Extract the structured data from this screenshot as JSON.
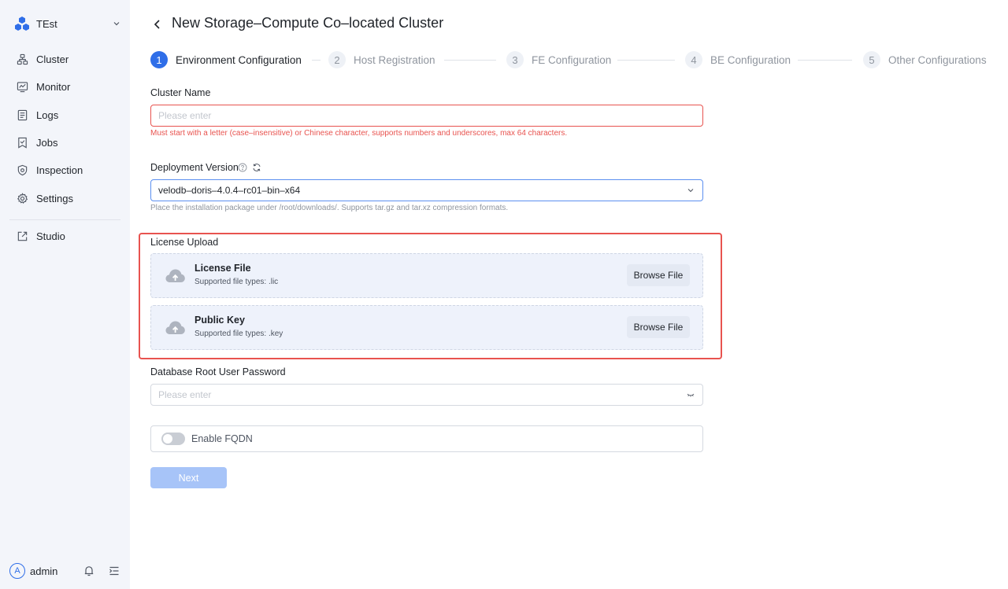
{
  "sidebar": {
    "workspace_name": "TEst",
    "items": [
      {
        "label": "Cluster",
        "icon": "cluster-icon"
      },
      {
        "label": "Monitor",
        "icon": "monitor-icon"
      },
      {
        "label": "Logs",
        "icon": "logs-icon"
      },
      {
        "label": "Jobs",
        "icon": "jobs-icon"
      },
      {
        "label": "Inspection",
        "icon": "inspection-icon"
      },
      {
        "label": "Settings",
        "icon": "settings-icon"
      }
    ],
    "studio_label": "Studio",
    "user": {
      "avatar_letter": "A",
      "name": "admin"
    }
  },
  "header": {
    "title": "New Storage–Compute Co–located Cluster"
  },
  "steps": [
    {
      "number": "1",
      "label": "Environment Configuration",
      "active": true
    },
    {
      "number": "2",
      "label": "Host Registration",
      "active": false
    },
    {
      "number": "3",
      "label": "FE Configuration",
      "active": false
    },
    {
      "number": "4",
      "label": "BE Configuration",
      "active": false
    },
    {
      "number": "5",
      "label": "Other Configurations",
      "active": false
    }
  ],
  "form": {
    "cluster_name": {
      "label": "Cluster Name",
      "placeholder": "Please enter",
      "value": "",
      "error": "Must start with a letter (case–insensitive) or Chinese character, supports numbers and underscores, max 64 characters."
    },
    "deployment_version": {
      "label": "Deployment Version",
      "value": "velodb–doris–4.0.4–rc01–bin–x64",
      "help": "Place the installation package under /root/downloads/. Supports tar.gz and tar.xz compression formats."
    },
    "license_upload": {
      "label": "License Upload",
      "files": [
        {
          "title": "License File",
          "subtitle": "Supported file types: .lic",
          "button": "Browse File"
        },
        {
          "title": "Public Key",
          "subtitle": "Supported file types: .key",
          "button": "Browse File"
        }
      ]
    },
    "root_password": {
      "label": "Database Root User Password",
      "placeholder": "Please enter",
      "value": ""
    },
    "fqdn": {
      "label": "Enable FQDN",
      "enabled": false
    },
    "next_label": "Next"
  },
  "colors": {
    "accent": "#2f6ee8",
    "error": "#e8534f",
    "sidebar_bg": "#f3f5fa",
    "next_disabled": "#a7c4f8"
  }
}
